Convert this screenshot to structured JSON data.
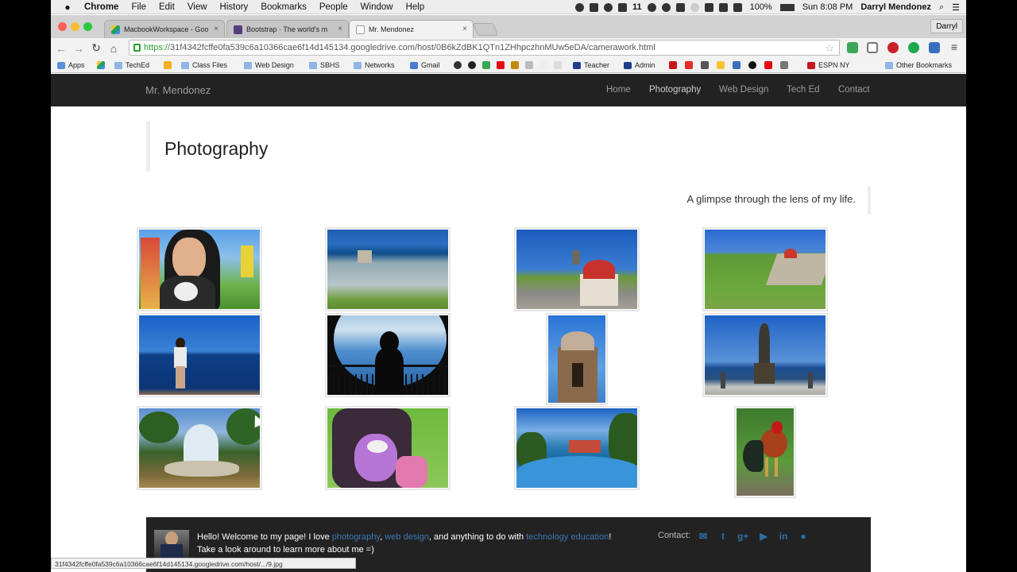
{
  "menubar": {
    "app": "Chrome",
    "items": [
      "File",
      "Edit",
      "View",
      "History",
      "Bookmarks",
      "People",
      "Window",
      "Help"
    ],
    "badge_count": "11",
    "battery": "100%",
    "clock": "Sun 8:08 PM",
    "user": "Darryl Mendonez"
  },
  "tabs": [
    {
      "title": "MacbookWorkspace - Goo"
    },
    {
      "title": "Bootstrap · The world's m"
    },
    {
      "title": "Mr. Mendonez"
    }
  ],
  "profile_name": "Darryl",
  "address": {
    "scheme": "https://",
    "rest": "31f4342fcffe0fa539c6a10366cae6f14d145134.googledrive.com/host/0B6kZdBK1QTn1ZHhpczhnMUw5eDA/camerawork.html"
  },
  "bookmarks": [
    {
      "label": "Apps",
      "type": "apps"
    },
    {
      "label": "TechEd",
      "type": "folder"
    },
    {
      "label": "Class Files",
      "type": "folder"
    },
    {
      "label": "Web Design",
      "type": "folder"
    },
    {
      "label": "SBHS",
      "type": "folder"
    },
    {
      "label": "Networks",
      "type": "folder"
    },
    {
      "label": "Gmail",
      "type": "link"
    },
    {
      "label": "Teacher",
      "type": "link"
    },
    {
      "label": "Admin",
      "type": "link"
    },
    {
      "label": "ESPN NY",
      "type": "link"
    },
    {
      "label": "Other Bookmarks",
      "type": "folder"
    }
  ],
  "site": {
    "brand": "Mr. Mendonez",
    "nav": [
      "Home",
      "Photography",
      "Web Design",
      "Tech Ed",
      "Contact"
    ],
    "active_nav": "Photography",
    "page_title": "Photography",
    "tagline": "A glimpse through the lens of my life."
  },
  "photos": [
    {
      "subject": "woman-with-dog"
    },
    {
      "subject": "coastal-cemetery"
    },
    {
      "subject": "red-dome-chapel"
    },
    {
      "subject": "fort-lawn"
    },
    {
      "subject": "woman-at-sea"
    },
    {
      "subject": "silhouette-balcony"
    },
    {
      "subject": "sentry-box"
    },
    {
      "subject": "statue-by-sea"
    },
    {
      "subject": "palm-fountain"
    },
    {
      "subject": "toy-in-stroller"
    },
    {
      "subject": "resort-pool"
    },
    {
      "subject": "rooster"
    }
  ],
  "footer": {
    "line1_a": "Hello! Welcome to my page! I love ",
    "link1": "photography",
    "sep1": ", ",
    "link2": "web design",
    "line1_b": ", and anything to do with ",
    "link3": "technology education",
    "line1_c": "!",
    "line2": "Take a look around to learn more about me =)",
    "contact_label": "Contact:",
    "social": [
      "envelope-icon",
      "twitter-icon",
      "google-plus-icon",
      "youtube-icon",
      "linkedin-icon",
      "github-icon"
    ]
  },
  "status_url": "31f4342fcffe0fa539c6a10366cae6f14d145134.googledrive.com/host/.../9.jpg",
  "colors": {
    "navbar": "#222222",
    "link": "#3a77b6",
    "social": "#2f6fa6"
  }
}
